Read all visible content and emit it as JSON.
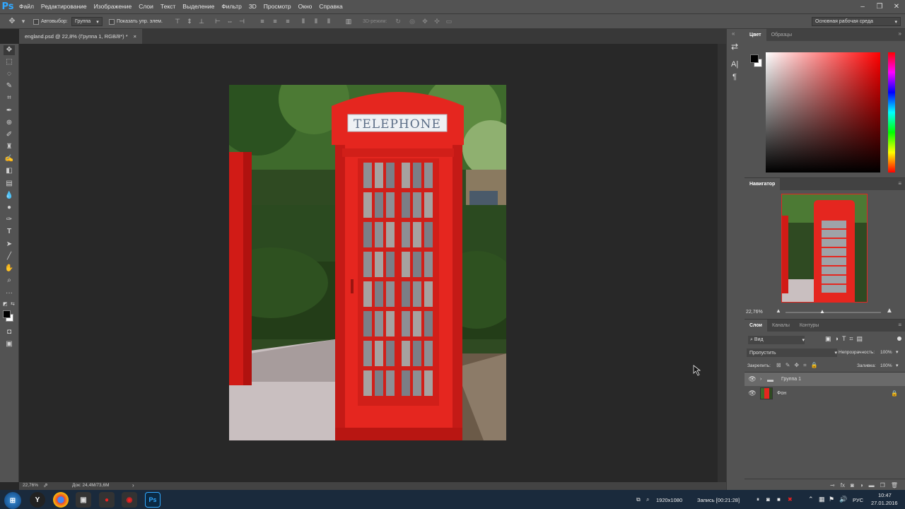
{
  "app": {
    "logo": "Ps"
  },
  "menu": [
    "Файл",
    "Редактирование",
    "Изображение",
    "Слои",
    "Текст",
    "Выделение",
    "Фильтр",
    "3D",
    "Просмотр",
    "Окно",
    "Справка"
  ],
  "options": {
    "autoselect_label": "Автовыбор:",
    "autoselect_value": "Группа",
    "show_transform_label": "Показать упр. элем.",
    "mode3d_label": "3D-режим:",
    "workspace": "Основная рабочая среда"
  },
  "document": {
    "tab_title": "england.psd @ 22,8% (Группа 1, RGB/8*) *",
    "close_glyph": "×",
    "zoom": "22,76%",
    "doc_size": "Док: 24,4M/73,6M"
  },
  "photo": {
    "sign_text": "TELEPHONE"
  },
  "color_panel": {
    "tabs": [
      "Цвет",
      "Образцы"
    ],
    "foreground": "#000000",
    "background": "#ffffff"
  },
  "navigator": {
    "title": "Навигатор",
    "zoom": "22,76%"
  },
  "layers_panel": {
    "tabs": [
      "Слои",
      "Каналы",
      "Контуры"
    ],
    "filter_kind": "Вид",
    "blend_mode": "Пропустить",
    "opacity_label": "Непрозрачность:",
    "opacity_value": "100%",
    "lock_label": "Закрепить:",
    "fill_label": "Заливка:",
    "fill_value": "100%",
    "layers": [
      {
        "name": "Группа 1",
        "type": "group",
        "visible": true,
        "selected": true
      },
      {
        "name": "Фон",
        "type": "pixel",
        "visible": true,
        "locked": true
      }
    ]
  },
  "taskbar": {
    "resolution": "1920x1080",
    "recording": "Запись [00:21:28]",
    "language": "РУС",
    "time": "10:47",
    "date": "27.01.2016"
  },
  "colors": {
    "accent_red": "#e5261f",
    "panel_bg": "#535353",
    "canvas_bg": "#282828"
  }
}
